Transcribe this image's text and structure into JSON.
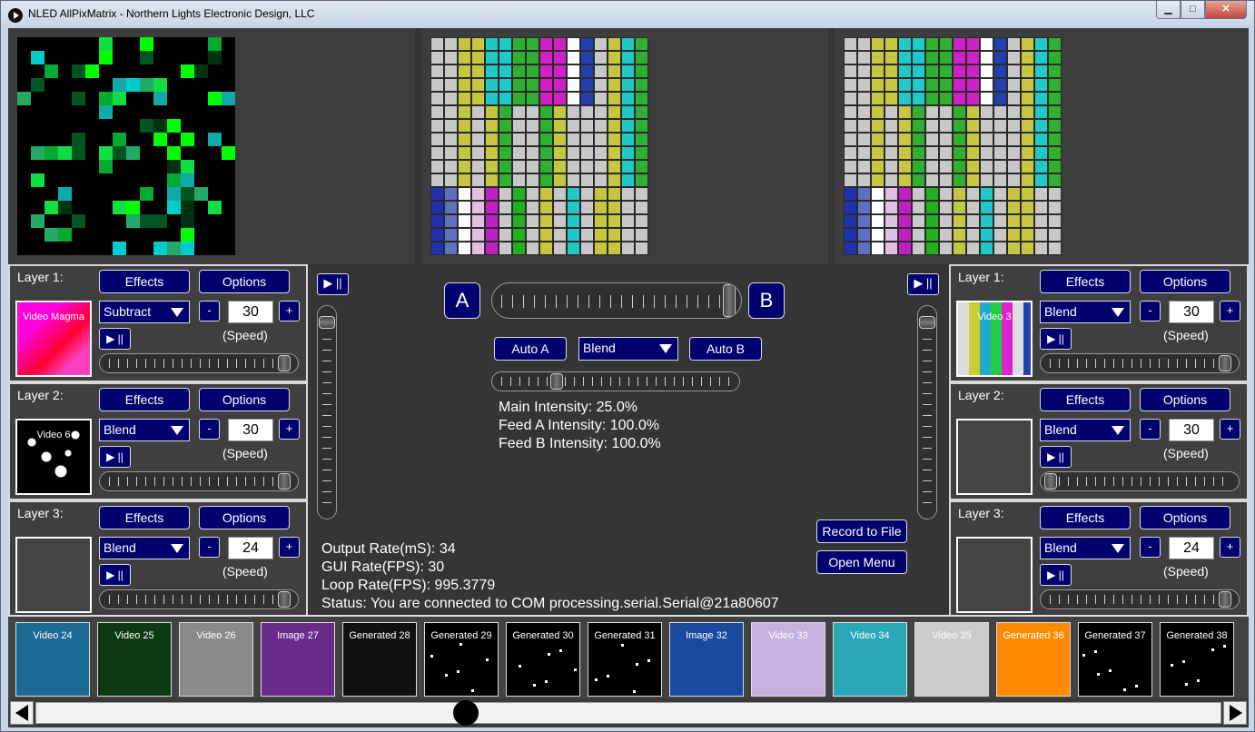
{
  "window": {
    "title": "NLED AllPixMatrix - Northern Lights Electronic Design, LLC",
    "controls": {
      "minimize": "▁",
      "maximize": "□",
      "close": "✕"
    }
  },
  "colors": {
    "button_bg": "#00006e",
    "panel_bg": "#3f3f3f",
    "background": "#353535",
    "text": "#ffffff"
  },
  "feed_a": {
    "layers": [
      {
        "label": "Layer 1:",
        "effects": "Effects",
        "options": "Options",
        "blend": "Subtract",
        "speed": "30",
        "speed_label": "(Speed)",
        "minus": "-",
        "plus": "+",
        "play": "▶ ||",
        "thumb_label": "Video Magma",
        "speed_slider": 0.97
      },
      {
        "label": "Layer 2:",
        "effects": "Effects",
        "options": "Options",
        "blend": "Blend",
        "speed": "30",
        "speed_label": "(Speed)",
        "minus": "-",
        "plus": "+",
        "play": "▶ ||",
        "thumb_label": "Video 6",
        "speed_slider": 0.97
      },
      {
        "label": "Layer 3:",
        "effects": "Effects",
        "options": "Options",
        "blend": "Blend",
        "speed": "24",
        "speed_label": "(Speed)",
        "minus": "-",
        "plus": "+",
        "play": "▶ ||",
        "thumb_label": "",
        "speed_slider": 0.97
      }
    ],
    "play": "▶ ||",
    "fader": 0.95
  },
  "feed_b": {
    "layers": [
      {
        "label": "Layer 1:",
        "effects": "Effects",
        "options": "Options",
        "blend": "Blend",
        "speed": "30",
        "speed_label": "(Speed)",
        "minus": "-",
        "plus": "+",
        "play": "▶ ||",
        "thumb_label": "Video 3",
        "speed_slider": 0.97
      },
      {
        "label": "Layer 2:",
        "effects": "Effects",
        "options": "Options",
        "blend": "Blend",
        "speed": "30",
        "speed_label": "(Speed)",
        "minus": "-",
        "plus": "+",
        "play": "▶ ||",
        "thumb_label": "",
        "speed_slider": 0.02
      },
      {
        "label": "Layer 3:",
        "effects": "Effects",
        "options": "Options",
        "blend": "Blend",
        "speed": "24",
        "speed_label": "(Speed)",
        "minus": "-",
        "plus": "+",
        "play": "▶ ||",
        "thumb_label": "",
        "speed_slider": 0.97
      }
    ],
    "play": "▶ ||",
    "fader": 0.95
  },
  "mixer": {
    "a_label": "A",
    "b_label": "B",
    "crossfade": 1.0,
    "auto_a": "Auto A",
    "auto_b": "Auto B",
    "mix_mode": "Blend",
    "main_intensity_slider": 0.25,
    "main_intensity": "Main Intensity: 25.0%",
    "feed_a_intensity": "Feed A Intensity: 100.0%",
    "feed_b_intensity": "Feed B Intensity: 100.0%",
    "record": "Record to File",
    "open_menu": "Open Menu"
  },
  "status": {
    "output_rate": "Output Rate(mS): 34",
    "gui_rate": "GUI Rate(FPS): 30",
    "loop_rate": "Loop Rate(FPS): 995.3779",
    "status": "Status: You are connected to COM processing.serial.Serial@21a80607"
  },
  "clips": [
    {
      "label": "Video 24",
      "bg": "#1d6a96"
    },
    {
      "label": "Video 25",
      "bg": "#0d3a12"
    },
    {
      "label": "Video 26",
      "bg": "#8a8a8a"
    },
    {
      "label": "Image 27",
      "bg": "#6a2a8a"
    },
    {
      "label": "Generated 28",
      "bg": "#111111"
    },
    {
      "label": "Generated 29",
      "bg": "#000000"
    },
    {
      "label": "Generated 30",
      "bg": "#000000"
    },
    {
      "label": "Generated 31",
      "bg": "#000000"
    },
    {
      "label": "Image 32",
      "bg": "#1a4aa0"
    },
    {
      "label": "Video 33",
      "bg": "#c8b0e0"
    },
    {
      "label": "Video 34",
      "bg": "#2aa8b8"
    },
    {
      "label": "Video 35",
      "bg": "#cccccc"
    },
    {
      "label": "Generated 36",
      "bg": "#ff8a00"
    },
    {
      "label": "Generated 37",
      "bg": "#000000"
    },
    {
      "label": "Generated 38",
      "bg": "#000000"
    }
  ],
  "scroll": {
    "position": 0.36
  }
}
